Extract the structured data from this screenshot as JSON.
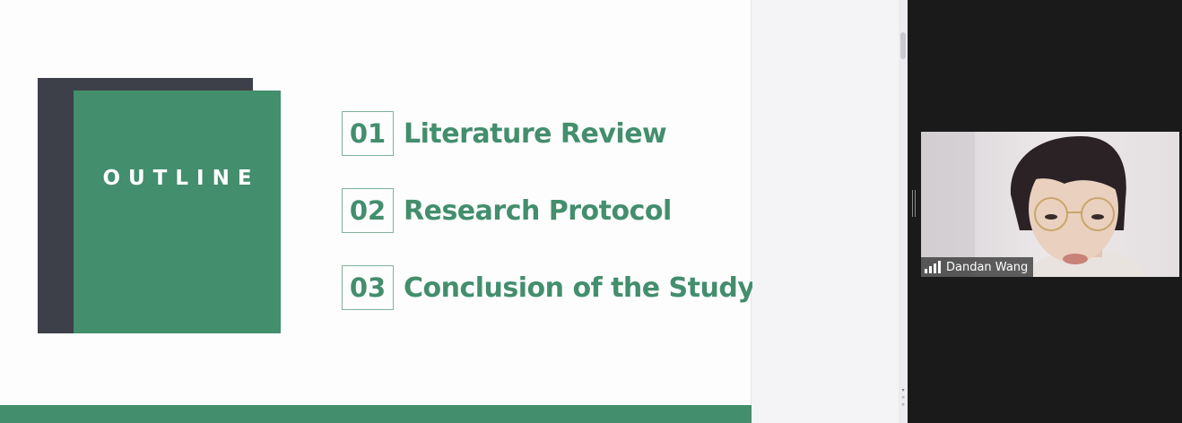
{
  "slide": {
    "outline_title": "OUTLINE",
    "items": [
      {
        "number": "01",
        "label": "Literature Review"
      },
      {
        "number": "02",
        "label": "Research Protocol"
      },
      {
        "number": "03",
        "label": "Conclusion of the Study"
      }
    ],
    "colors": {
      "accent": "#438e6d",
      "dark": "#3d4048",
      "background": "#fdfdfe"
    }
  },
  "video": {
    "participant_name": "Dandan Wang",
    "status_icon": "signal-strength-icon"
  }
}
